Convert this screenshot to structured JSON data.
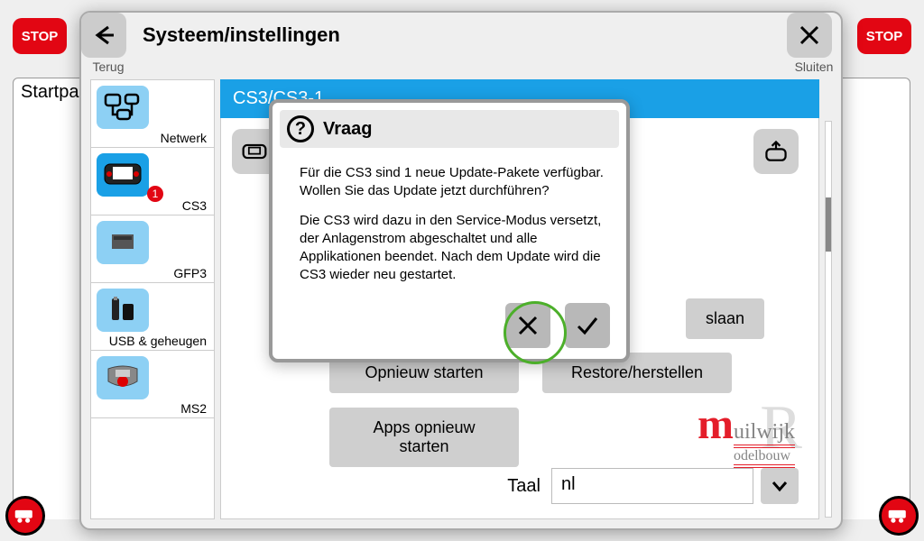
{
  "background": {
    "start_tab": "Startpa"
  },
  "stop_label": "STOP",
  "window": {
    "back_label": "Terug",
    "close_label": "Sluiten",
    "title": "Systeem/instellingen"
  },
  "sidebar": {
    "items": [
      {
        "label": "Netwerk"
      },
      {
        "label": "CS3",
        "badge": "1"
      },
      {
        "label": "GFP3"
      },
      {
        "label": "USB & geheugen"
      },
      {
        "label": "MS2"
      }
    ]
  },
  "main": {
    "header": "CS3/CS3-1",
    "save_label": "slaan",
    "buttons": {
      "restart": "Opnieuw starten",
      "restore": "Restore/herstellen",
      "restart_apps": "Apps opnieuw starten"
    },
    "lang_label": "Taal",
    "lang_value": "nl"
  },
  "modal": {
    "title": "Vraag",
    "p1": "Für die CS3 sind 1 neue Update-Pakete verfügbar. Wollen Sie das Update jetzt durchführen?",
    "p2": "Die CS3 wird dazu in den Service-Modus versetzt, der Anlagenstrom abgeschaltet und alle Applikationen beendet. Nach dem Update wird die CS3 wieder neu gestartet."
  },
  "watermark": {
    "m": "m",
    "rest": "uilwijk",
    "sub": "odelbouw"
  }
}
